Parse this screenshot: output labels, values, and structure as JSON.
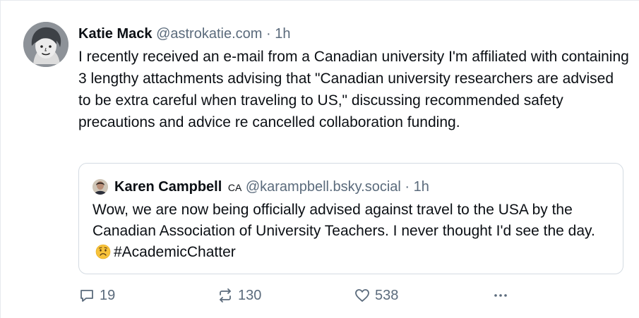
{
  "post": {
    "author_name": "Katie Mack",
    "author_handle": "@astrokatie.com",
    "separator": "·",
    "time": "1h",
    "text": "I recently received an e-mail from a Canadian university I'm affiliated with containing 3 lengthy attachments advising that \"Canadian university researchers are advised to be extra careful when traveling to US,\" discussing recommended safety precautions and advice re cancelled collaboration funding.",
    "avatar_icon": "cartoon-avatar-icon"
  },
  "quote": {
    "author_name": "Karen Campbell",
    "badge": "CA",
    "author_handle": "@karampbell.bsky.social",
    "separator": "·",
    "time": "1h",
    "text_before": "Wow, we are now being officially advised against travel to the USA by the Canadian Association of University Teachers. I never thought I'd see the day.",
    "emoji": "worried-face-emoji",
    "text_after": "#AcademicChatter",
    "avatar_icon": "profile-photo-icon"
  },
  "actions": {
    "reply_count": "19",
    "repost_count": "130",
    "like_count": "538",
    "reply_icon": "reply-icon",
    "repost_icon": "repost-icon",
    "like_icon": "heart-icon",
    "more_icon": "more-dots-icon"
  },
  "colors": {
    "text": "#0b0f14",
    "muted": "#5b6b7c",
    "border": "#d4dbe2"
  }
}
